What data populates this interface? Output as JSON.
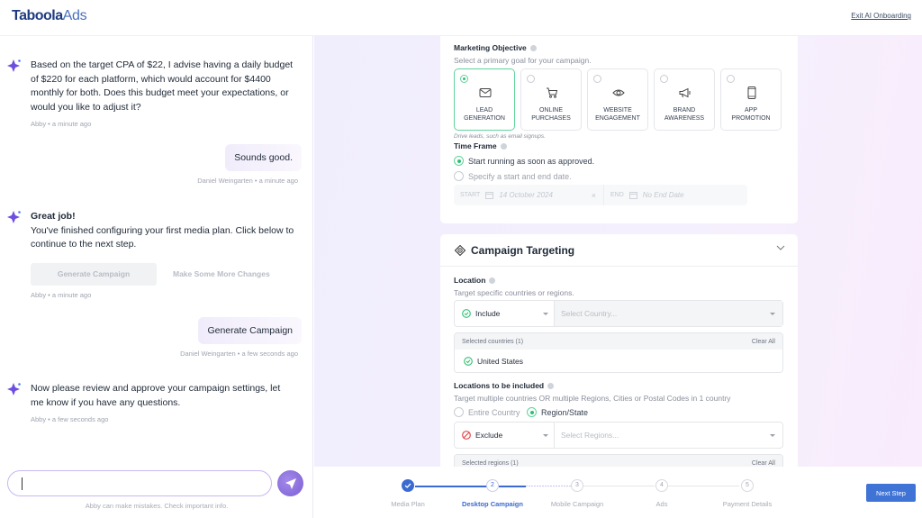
{
  "header": {
    "logo_main": "Taboola",
    "logo_suffix": "Ads",
    "exit_link": "Exit AI Onboarding"
  },
  "chat": {
    "messages": [
      {
        "sender": "ai",
        "text": "Based on the target CPA of $22, I advise having a daily budget of $220 for each platform, which would account for $4400 monthly for both. Does this budget meet your expectations, or would you like to adjust it?",
        "meta": "Abby • a minute ago"
      },
      {
        "sender": "user",
        "text": "Sounds good.",
        "meta": "Daniel Weingarten • a minute ago"
      },
      {
        "sender": "ai",
        "title": "Great job!",
        "text": "You've finished configuring your first media plan. Click below to continue to the next step.",
        "meta": "Abby • a minute ago",
        "buttons": [
          "Generate Campaign",
          "Make Some More Changes"
        ]
      },
      {
        "sender": "user",
        "text": "Generate Campaign",
        "meta": "Daniel Weingarten • a few seconds ago"
      },
      {
        "sender": "ai",
        "text": "Now please review and approve your campaign settings, let me know if you have any questions.",
        "meta": "Abby • a few seconds ago"
      }
    ],
    "input_value": "",
    "disclaimer": "Abby can make mistakes. Check important info."
  },
  "objective": {
    "label": "Marketing Objective",
    "subtitle": "Select a primary goal for your campaign.",
    "options": [
      {
        "line1": "LEAD",
        "line2": "GENERATION",
        "icon": "envelope-icon",
        "selected": true
      },
      {
        "line1": "ONLINE",
        "line2": "PURCHASES",
        "icon": "cart-icon",
        "selected": false
      },
      {
        "line1": "WEBSITE",
        "line2": "ENGAGEMENT",
        "icon": "eye-icon",
        "selected": false
      },
      {
        "line1": "BRAND",
        "line2": "AWARENESS",
        "icon": "megaphone-icon",
        "selected": false
      },
      {
        "line1": "APP",
        "line2": "PROMOTION",
        "icon": "phone-icon",
        "selected": false
      }
    ],
    "hint": "Drive leads, such as email signups."
  },
  "timeframe": {
    "label": "Time Frame",
    "option1": "Start running as soon as approved.",
    "option2": "Specify a start and end date.",
    "start_label": "START",
    "start_value": "14 October 2024",
    "end_label": "END",
    "end_placeholder": "No End Date"
  },
  "targeting": {
    "title": "Campaign Targeting",
    "location_label": "Location",
    "location_sub": "Target specific countries or regions.",
    "include_label": "Include",
    "country_placeholder": "Select Country...",
    "selected_countries_header": "Selected countries (1)",
    "clear_all": "Clear All",
    "selected_country": "United States",
    "locations_label": "Locations to be included",
    "locations_sub": "Target multiple countries OR multiple Regions, Cities or Postal Codes in 1 country",
    "entire_country": "Entire Country",
    "region_state": "Region/State",
    "exclude_label": "Exclude",
    "regions_placeholder": "Select Regions...",
    "selected_regions_header": "Selected regions (1)"
  },
  "stepper": {
    "steps": [
      {
        "num": "1",
        "label": "Media Plan",
        "state": "done"
      },
      {
        "num": "2",
        "label": "Desktop Campaign",
        "state": "current"
      },
      {
        "num": "3",
        "label": "Mobile Campaign",
        "state": "todo"
      },
      {
        "num": "4",
        "label": "Ads",
        "state": "todo"
      },
      {
        "num": "5",
        "label": "Payment Details",
        "state": "todo"
      }
    ],
    "next_button": "Next Step"
  },
  "colors": {
    "accent": "#3f74d6",
    "success": "#2fbf71",
    "danger": "#e5484d",
    "ai_purple": "#7c5fd6"
  }
}
